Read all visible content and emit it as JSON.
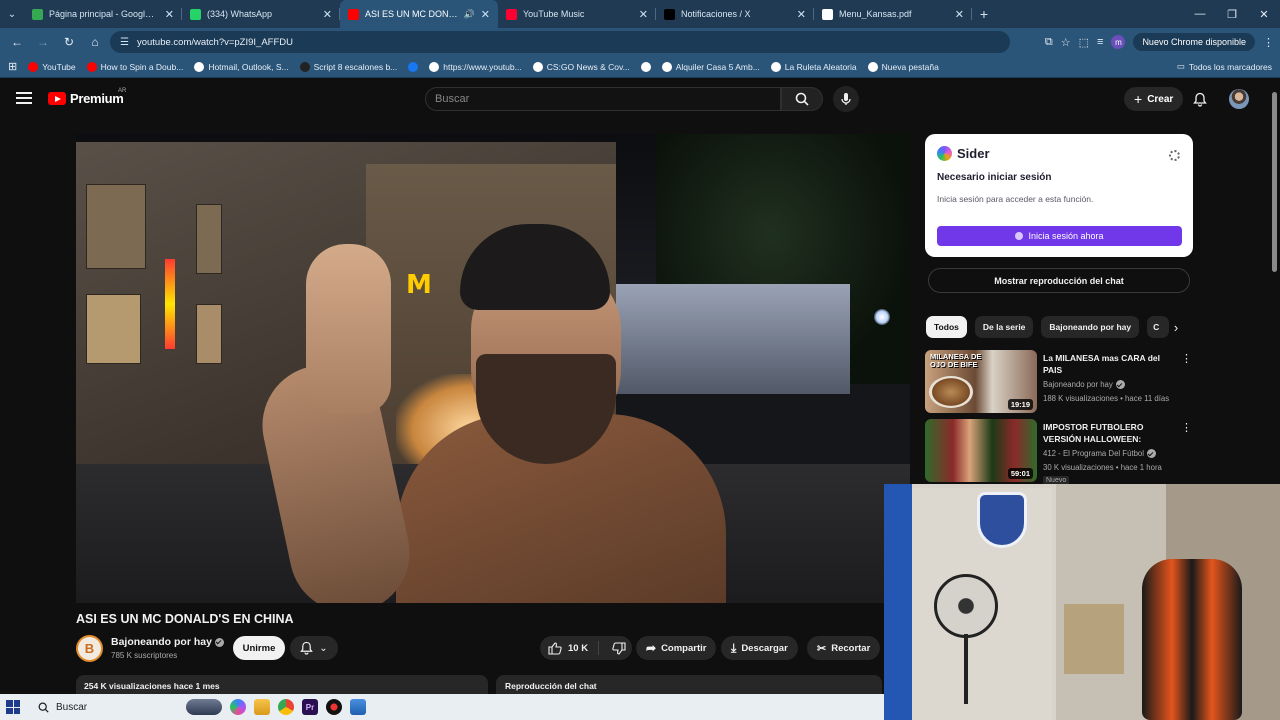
{
  "browser": {
    "tabs": [
      {
        "title": "Página principal - Google Drive",
        "color": "#34a853",
        "active": false
      },
      {
        "title": "(334) WhatsApp",
        "color": "#25d366",
        "active": false
      },
      {
        "title": "ASI ES UN MC DONALD'S E",
        "color": "#ff0000",
        "active": true
      },
      {
        "title": "YouTube Music",
        "color": "#ff0033",
        "active": false
      },
      {
        "title": "Notificaciones / X",
        "color": "#000000",
        "active": false
      },
      {
        "title": "Menu_Kansas.pdf",
        "color": "#ffffff",
        "active": false
      }
    ],
    "url": "youtube.com/watch?v=pZI9I_AFFDU",
    "update_label": "Nuevo Chrome disponible",
    "profile_initial": "m",
    "bookmarks": [
      {
        "label": "YouTube",
        "color": "#ff0000"
      },
      {
        "label": "How to Spin a Doub...",
        "color": "#ff0000"
      },
      {
        "label": "Hotmail, Outlook, S...",
        "color": "#ffffff"
      },
      {
        "label": "Script 8 escalones b...",
        "color": "#222222"
      },
      {
        "label": "",
        "color": "#1877f2"
      },
      {
        "label": "https://www.youtub...",
        "color": "#ffffff"
      },
      {
        "label": "CS:GO News & Cov...",
        "color": "#ffffff"
      },
      {
        "label": "",
        "color": "#ffffff"
      },
      {
        "label": "Alquiler Casa 5 Amb...",
        "color": "#ffffff"
      },
      {
        "label": "La Ruleta Aleatoria",
        "color": "#ffffff"
      },
      {
        "label": "Nueva pestaña",
        "color": "#ffffff"
      }
    ],
    "all_bookmarks": "Todos los marcadores"
  },
  "yt": {
    "logo": "Premium",
    "region": "AR",
    "search_placeholder": "Buscar",
    "create_label": "Crear"
  },
  "video": {
    "title": "ASI ES UN MC DONALD'S EN CHINA",
    "channel": "Bajoneando por hay",
    "channel_initial": "B",
    "subscribers": "785 K suscriptores",
    "join_label": "Unirme",
    "likes": "10 K",
    "share_label": "Compartir",
    "download_label": "Descargar",
    "clip_label": "Recortar",
    "views_date": "254 K visualizaciones  hace 1 mes",
    "chat_replay_bar": "Reproducción del chat"
  },
  "sider": {
    "brand": "Sider",
    "heading": "Necesario iniciar sesión",
    "text": "Inicia sesión para acceder a esta función.",
    "button": "Inicia sesión ahora"
  },
  "sidebar": {
    "show_chat": "Mostrar reproducción del chat",
    "chips": [
      "Todos",
      "De la serie",
      "Bajoneando por hay",
      "C"
    ],
    "recommendations": [
      {
        "title": "La MILANESA mas CARA del PAIS",
        "channel": "Bajoneando por hay",
        "meta": "188 K visualizaciones • hace 11 días",
        "duration": "19:19",
        "thumb_text": "MILANESA DE OJO DE BIFE"
      },
      {
        "title": "IMPOSTOR FUTBOLERO VERSIÓN HALLOWEEN: ¿QUIE...",
        "channel": "412 - El Programa Del Fútbol",
        "meta": "30 K visualizaciones • hace 1 hora",
        "duration": "59:01",
        "badge": "Nuevo"
      }
    ]
  },
  "taskbar": {
    "search_label": "Buscar"
  }
}
